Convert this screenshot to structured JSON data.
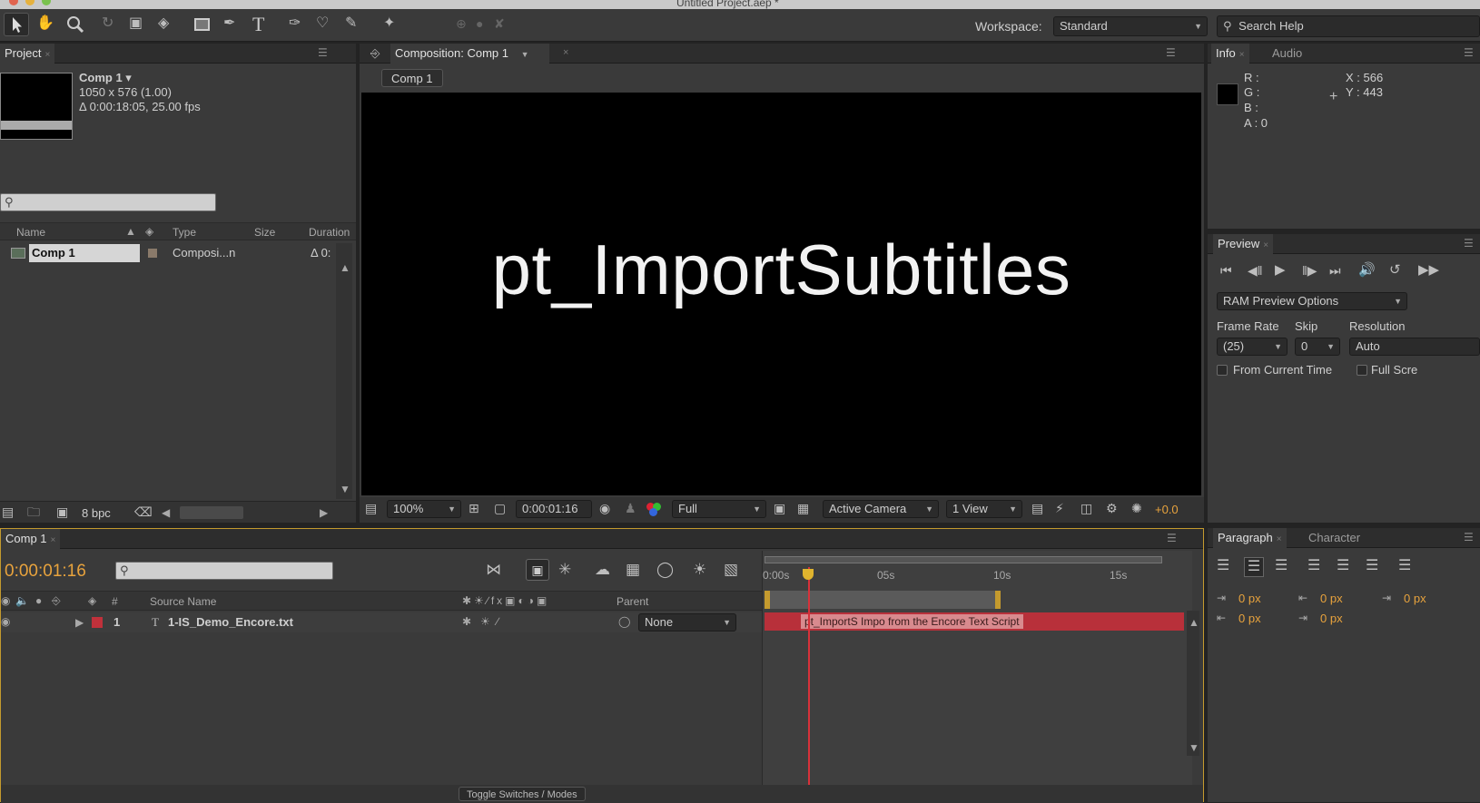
{
  "window": {
    "title": "Untitled Project.aep *"
  },
  "toolbar": {
    "workspace_label": "Workspace:",
    "workspace_value": "Standard",
    "search_placeholder": "Search Help"
  },
  "project": {
    "tab": "Project",
    "comp_name": "Comp 1 ▾",
    "comp_dims": "1050 x 576 (1.00)",
    "comp_duration": "Δ 0:00:18:05, 25.00 fps",
    "columns": {
      "name": "Name",
      "type": "Type",
      "size": "Size",
      "duration": "Duration"
    },
    "items": [
      {
        "name": "Comp 1",
        "type": "Composi...n",
        "duration": "Δ 0:"
      }
    ],
    "bpc": "8 bpc"
  },
  "composition": {
    "tab": "Composition: Comp 1",
    "crumb": "Comp 1",
    "viewer_text": "pt_ImportSubtitles",
    "zoom": "100%",
    "timecode": "0:00:01:16",
    "resolution": "Full",
    "camera": "Active Camera",
    "views": "1 View",
    "exposure": "+0.0"
  },
  "info": {
    "tab_info": "Info",
    "tab_audio": "Audio",
    "r": "R :",
    "g": "G :",
    "b": "B :",
    "a": "A : 0",
    "x": "X : 566",
    "y": "Y : 443"
  },
  "preview": {
    "tab": "Preview",
    "ram_options": "RAM Preview Options",
    "frame_rate_label": "Frame Rate",
    "skip_label": "Skip",
    "resolution_label": "Resolution",
    "frame_rate": "(25)",
    "skip": "0",
    "resolution": "Auto",
    "from_current": "From Current Time",
    "full_screen": "Full Scre"
  },
  "timeline": {
    "tab": "Comp 1",
    "timecode": "0:00:01:16",
    "columns": {
      "source": "Source Name",
      "parent": "Parent",
      "num": "#"
    },
    "ruler": [
      "0:00s",
      "05s",
      "10s",
      "15s"
    ],
    "layers": [
      {
        "num": "1",
        "name": "1-IS_Demo_Encore.txt",
        "parent": "None"
      }
    ],
    "layer_bar_text": "pt_ImportS  Impo  from the Encore Text Script",
    "bottom_button": "Toggle Switches / Modes"
  },
  "paragraph": {
    "tab_paragraph": "Paragraph",
    "tab_character": "Character",
    "indent_left": "0 px",
    "indent_right": "0 px",
    "indent_first": "0 px",
    "space_before": "0 px",
    "space_after": "0 px"
  }
}
